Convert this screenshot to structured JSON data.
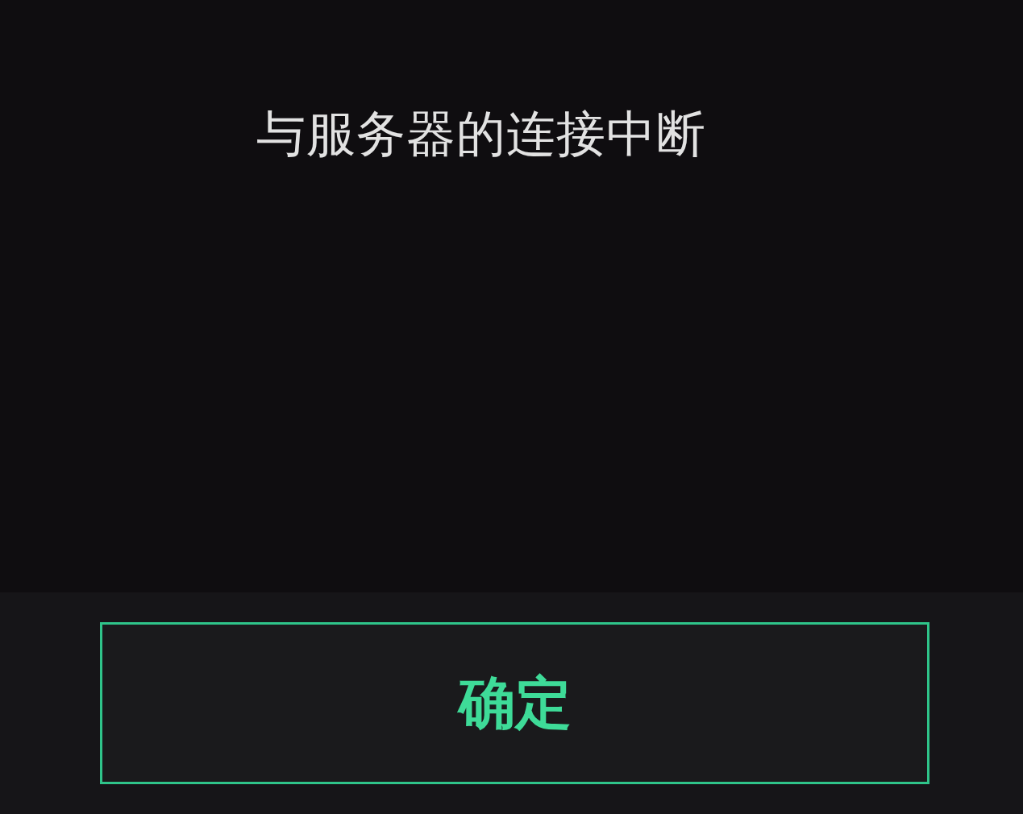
{
  "dialog": {
    "message": "与服务器的连接中断",
    "confirm_button": "确定"
  }
}
